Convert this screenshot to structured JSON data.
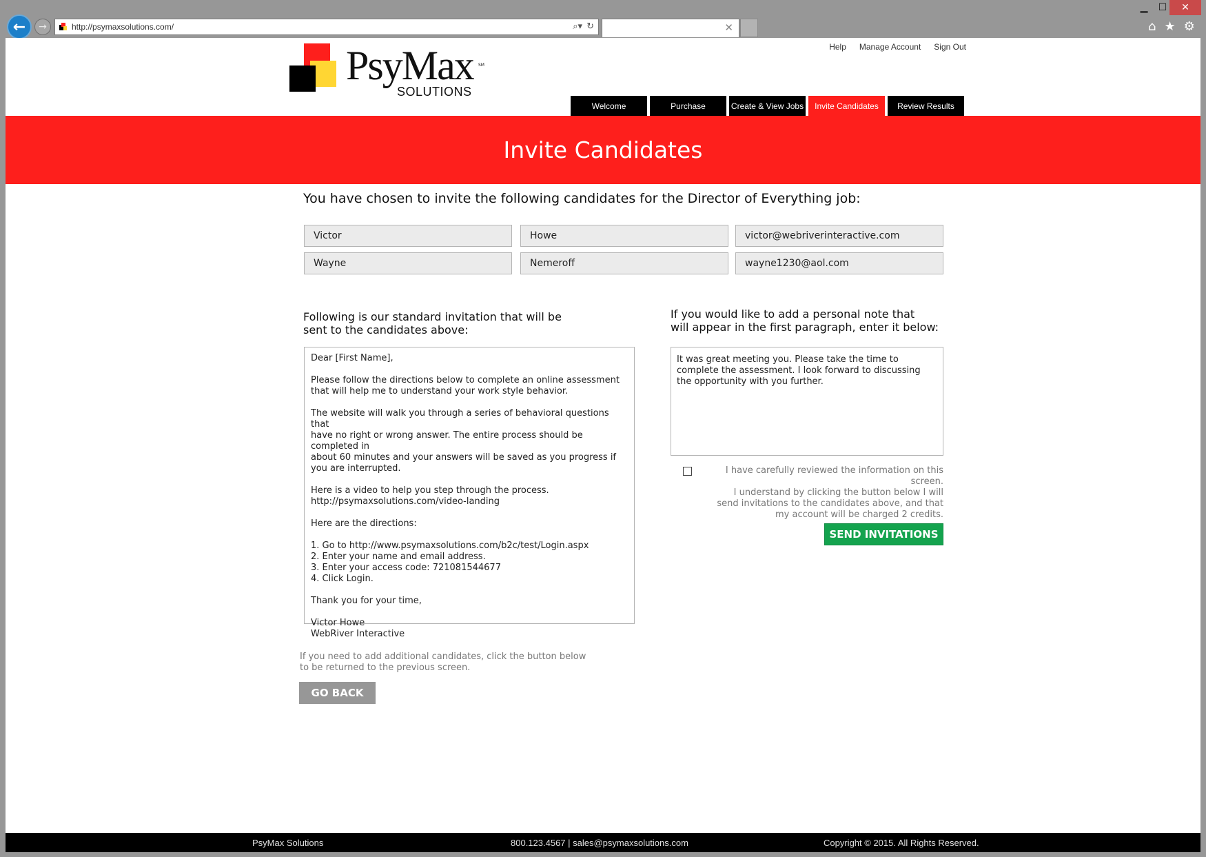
{
  "browser": {
    "url": "http://psymaxsolutions.com/",
    "back_icon": "back-arrow-icon",
    "forward_icon": "forward-arrow-icon",
    "search_icon": "⌕▾",
    "refresh_icon": "↻",
    "tab_close": "✕",
    "window_controls": {
      "minimize": "▁",
      "maximize": "☐",
      "close": "✕"
    },
    "tools": {
      "home": "⌂",
      "favorites": "★",
      "settings": "⚙"
    }
  },
  "header": {
    "logo_text": "PsyMax",
    "logo_sub": "SOLUTIONS",
    "logo_tm": "SM",
    "brand_colors": {
      "red": "#fe1f1c",
      "yellow": "#ffd633",
      "black": "#000000"
    },
    "top_links": [
      "Help",
      "Manage Account",
      "Sign Out"
    ],
    "nav": [
      {
        "label": "Welcome",
        "active": false
      },
      {
        "label": "Purchase",
        "active": false
      },
      {
        "label": "Create & View Jobs",
        "active": false
      },
      {
        "label": "Invite Candidates",
        "active": true
      },
      {
        "label": "Review Results",
        "active": false
      }
    ]
  },
  "banner": {
    "title": "Invite Candidates"
  },
  "main": {
    "intro": "You have chosen to invite the following candidates for the Director of Everything job:",
    "candidates": [
      {
        "first": "Victor",
        "last": "Howe",
        "email": "victor@webriverinteractive.com"
      },
      {
        "first": "Wayne",
        "last": "Nemeroff",
        "email": "wayne1230@aol.com"
      }
    ],
    "letter_title": "Following is our standard invitation that will be\nsent to the candidates above:",
    "letter_body": "Dear [First Name],\n\nPlease follow the directions below to complete an online assessment\nthat will help me to understand your work style behavior.\n\nThe website will walk you through a series of behavioral questions that\nhave no right or wrong answer. The entire process should be completed in\nabout 60 minutes and your answers will be saved as you progress if\nyou are interrupted.\n\nHere is a video to help you step through the process.\nhttp://psymaxsolutions.com/video-landing\n\nHere are the directions:\n\n1. Go to http://www.psymaxsolutions.com/b2c/test/Login.aspx\n2. Enter your name and email address.\n3. Enter your access code: 721081544677\n4. Click Login.\n\nThank you for your time,\n\nVictor Howe\nWebRiver Interactive",
    "note_title": "If you would like to add a personal note that\nwill appear in the first paragraph, enter it below:",
    "note_value": "It was great meeting you. Please take the time to complete the assessment. I look forward to discussing the opportunity with you further.",
    "ack_checked": false,
    "ack_text": "I have carefully reviewed the information on this screen.\nI understand by clicking the button below I will\nsend invitations to the candidates above, and that\nmy account will be charged 2 credits.",
    "send_label": "SEND INVITATIONS",
    "back_note": "If you need to add additional candidates, click the button below\nto be returned to the previous screen.",
    "go_back_label": "GO BACK"
  },
  "footer": {
    "company": "PsyMax Solutions",
    "contact": "800.123.4567 | sales@psymaxsolutions.com",
    "copyright": "Copyright © 2015. All Rights Reserved."
  }
}
